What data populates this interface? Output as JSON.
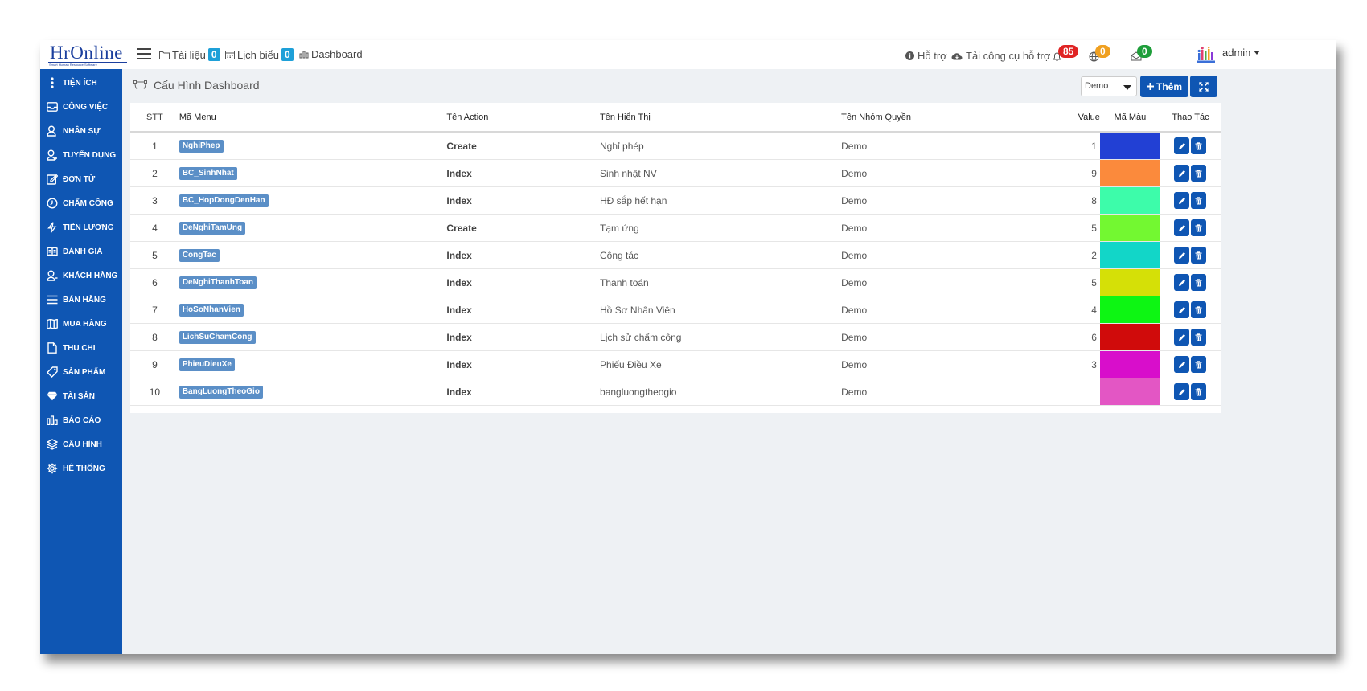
{
  "app": {
    "logo_text": "HrOnline",
    "logo_sub": "Smart Human Resource Software"
  },
  "topbar": {
    "nav": [
      {
        "label": "Tài liệu",
        "count": "0",
        "icon": "folder-icon"
      },
      {
        "label": "Lịch biểu",
        "count": "0",
        "icon": "calendar-icon"
      },
      {
        "label": "Dashboard",
        "icon": "bar-chart-icon"
      }
    ],
    "support_label": "Hỗ trợ",
    "tools_label": "Tải công cụ hỗ trợ",
    "notifications": [
      {
        "icon": "bell-icon",
        "count": "85",
        "color": "#e02424"
      },
      {
        "icon": "globe-icon",
        "count": "0",
        "color": "#f0a020"
      },
      {
        "icon": "mail-icon",
        "count": "0",
        "color": "#1e9e3a"
      }
    ],
    "user_name": "admin"
  },
  "sidebar": {
    "items": [
      {
        "label": "TIỆN ÍCH",
        "icon": "more-vertical-icon"
      },
      {
        "label": "CÔNG VIỆC",
        "icon": "inbox-icon"
      },
      {
        "label": "NHÂN SỰ",
        "icon": "user-icon"
      },
      {
        "label": "TUYỂN DỤNG",
        "icon": "user-plus-icon"
      },
      {
        "label": "ĐƠN TỪ",
        "icon": "edit-icon"
      },
      {
        "label": "CHẤM CÔNG",
        "icon": "clock-icon"
      },
      {
        "label": "TIỀN LƯƠNG",
        "icon": "lightning-icon"
      },
      {
        "label": "ĐÁNH GIÁ",
        "icon": "book-icon"
      },
      {
        "label": "KHÁCH HÀNG",
        "icon": "customer-icon"
      },
      {
        "label": "BÁN HÀNG",
        "icon": "list-icon"
      },
      {
        "label": "MUA HÀNG",
        "icon": "map-icon"
      },
      {
        "label": "THU CHI",
        "icon": "file-icon"
      },
      {
        "label": "SẢN PHẨM",
        "icon": "tag-icon"
      },
      {
        "label": "TÀI SẢN",
        "icon": "diamond-icon"
      },
      {
        "label": "BÁO CÁO",
        "icon": "report-chart-icon"
      },
      {
        "label": "CẤU HÌNH",
        "icon": "layers-icon"
      },
      {
        "label": "HỆ THỐNG",
        "icon": "gear-icon"
      }
    ]
  },
  "page": {
    "title": "Cấu Hình Dashboard",
    "filter_value": "Demo",
    "add_label": "Thêm"
  },
  "table": {
    "headers": {
      "stt": "STT",
      "menu": "Mã Menu",
      "action": "Tên Action",
      "display": "Tên Hiển Thị",
      "group": "Tên Nhóm Quyền",
      "value": "Value",
      "color": "Mã Màu",
      "ops": "Thao Tác"
    },
    "rows": [
      {
        "stt": "1",
        "menu": "NghiPhep",
        "action": "Create",
        "display": "Nghỉ phép",
        "group": "Demo",
        "value": "1",
        "color": "#2240d4"
      },
      {
        "stt": "2",
        "menu": "BC_SinhNhat",
        "action": "Index",
        "display": "Sinh nhật NV",
        "group": "Demo",
        "value": "9",
        "color": "#fb8a3c"
      },
      {
        "stt": "3",
        "menu": "BC_HopDongDenHan",
        "action": "Index",
        "display": "HĐ sắp hết hạn",
        "group": "Demo",
        "value": "8",
        "color": "#3dfcaa"
      },
      {
        "stt": "4",
        "menu": "DeNghiTamUng",
        "action": "Create",
        "display": "Tạm ứng",
        "group": "Demo",
        "value": "5",
        "color": "#73f831"
      },
      {
        "stt": "5",
        "menu": "CongTac",
        "action": "Index",
        "display": "Công tác",
        "group": "Demo",
        "value": "2",
        "color": "#12d6c8"
      },
      {
        "stt": "6",
        "menu": "DeNghiThanhToan",
        "action": "Index",
        "display": "Thanh toán",
        "group": "Demo",
        "value": "5",
        "color": "#d5e007"
      },
      {
        "stt": "7",
        "menu": "HoSoNhanVien",
        "action": "Index",
        "display": "Hồ Sơ Nhân Viên",
        "group": "Demo",
        "value": "4",
        "color": "#0df613"
      },
      {
        "stt": "8",
        "menu": "LichSuChamCong",
        "action": "Index",
        "display": "Lịch sử chấm công",
        "group": "Demo",
        "value": "6",
        "color": "#d00b0b"
      },
      {
        "stt": "9",
        "menu": "PhieuDieuXe",
        "action": "Index",
        "display": "Phiếu Điều Xe",
        "group": "Demo",
        "value": "3",
        "color": "#d80ecb"
      },
      {
        "stt": "10",
        "menu": "BangLuongTheoGio",
        "action": "Index",
        "display": "bangluongtheogio",
        "group": "Demo",
        "value": "",
        "color": "#e356c4"
      }
    ]
  }
}
